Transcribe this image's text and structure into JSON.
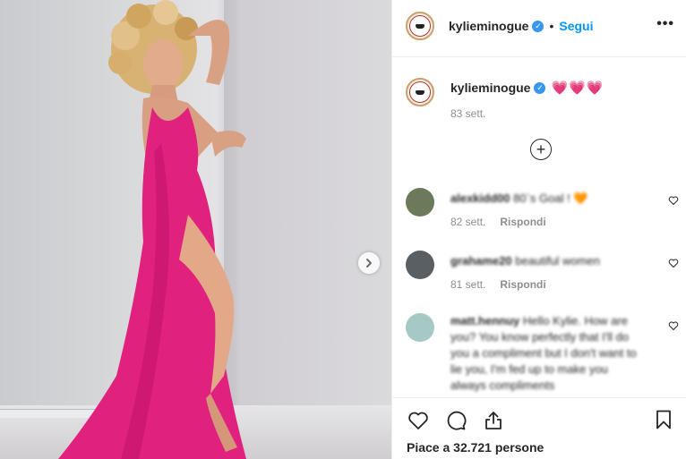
{
  "post": {
    "username": "kylieminogue",
    "follow_label": "Segui",
    "separator": "•",
    "more_label": "•••",
    "next_arrow": "›"
  },
  "caption": {
    "username": "kylieminogue",
    "text": "💗💗💗",
    "time": "83 sett."
  },
  "load_more_label": "+",
  "comments": [
    {
      "user": "alexkidd00",
      "body": "80`s Goal ! 🧡",
      "time": "82 sett.",
      "reply_label": "Rispondi",
      "avatar_color": "#6b7a5a"
    },
    {
      "user": "grahame20",
      "body": "beautiful women",
      "time": "81 sett.",
      "reply_label": "Rispondi",
      "avatar_color": "#5a5f63"
    },
    {
      "user": "matt.hennuy",
      "body": "Hello Kylie. How are you? You know perfectly that I'll do you a compliment but I don't want to lie you, I'm fed up to make you always compliments",
      "avatar_color": "#a6c9c6"
    }
  ],
  "footer": {
    "likes_text": "Piace a 32.721 persone"
  },
  "icons": {
    "like": "heart-icon",
    "comment": "comment-icon",
    "share": "share-icon",
    "save": "bookmark-icon",
    "verified": "verified-badge-icon"
  },
  "colors": {
    "accent": "#0095f6",
    "verified": "#3897f0",
    "dress": "#e0217d",
    "text_secondary": "#8e8e8e"
  }
}
